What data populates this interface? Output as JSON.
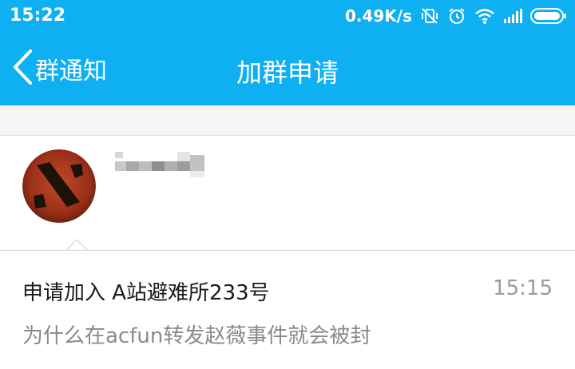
{
  "status_bar": {
    "time": "15:22",
    "network_speed": "0.49K/s",
    "icons": [
      "vibrate-off-icon",
      "alarm-icon",
      "wifi-icon",
      "signal-icon",
      "battery-icon"
    ]
  },
  "nav": {
    "back_label": "群通知",
    "title": "加群申请"
  },
  "applicant": {
    "avatar": "dota-logo"
  },
  "request": {
    "title": "申请加入 A站避难所233号",
    "time": "15:15",
    "message": "为什么在acfun转发赵薇事件就会被封"
  },
  "colors": {
    "header": "#0eb0f2",
    "background": "#f5f5f7",
    "text_primary": "#1a1a1a",
    "text_secondary": "#8a8a8a"
  }
}
